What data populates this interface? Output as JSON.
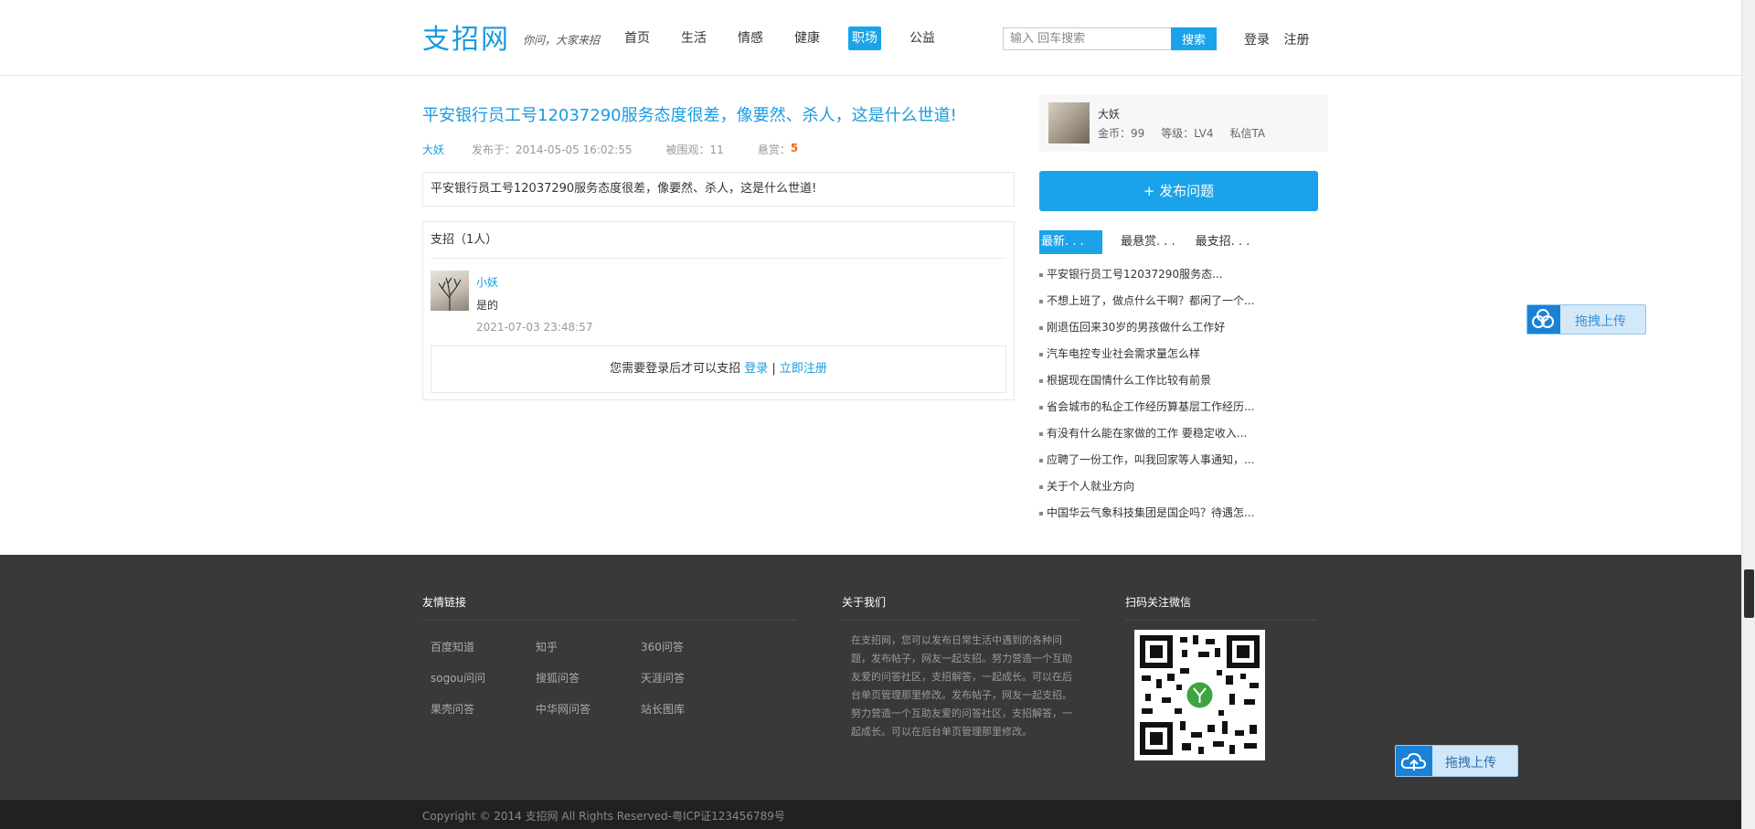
{
  "header": {
    "logo": "支招网",
    "slogan": "你问，大家来招",
    "nav": [
      "首页",
      "生活",
      "情感",
      "健康",
      "职场",
      "公益"
    ],
    "active_nav": "职场",
    "search": {
      "placeholder": "输入 回车搜索",
      "button": "搜索"
    },
    "login": "登录",
    "register": "注册"
  },
  "question": {
    "title": "平安银行员工号12037290服务态度很差，像要然、杀人，这是什么世道!",
    "author": "大妖",
    "published": "发布于：2014-05-05 16:02:55",
    "views": "被围观：11",
    "reward_label": "悬赏：",
    "reward": "5",
    "body": "平安银行员工号12037290服务态度很差，像要然、杀人，这是什么世道!"
  },
  "answers": {
    "header": "支招（1人）",
    "items": [
      {
        "user": "小妖",
        "text": "是的",
        "time": "2021-07-03 23:48:57"
      }
    ],
    "login_tip": "您需要登录后才可以支招",
    "login_link": "登录",
    "separator": "|",
    "register_link": "立即注册"
  },
  "user_card": {
    "name": "大妖",
    "coins": "金币：99",
    "level": "等级：LV4",
    "message": "私信TA"
  },
  "post_button": "+ 发布问题",
  "tabs": [
    "最新. . .",
    "最悬赏. . .",
    "最支招. . ."
  ],
  "latest_list": [
    "平安银行员工号12037290服务态...",
    "不想上班了，做点什么干啊？都闲了一个...",
    "刚退伍回来30岁的男孩做什么工作好",
    "汽车电控专业社会需求量怎么样",
    "根据现在国情什么工作比较有前景",
    "省会城市的私企工作经历算基层工作经历...",
    "有没有什么能在家做的工作 要稳定收入...",
    "应聘了一份工作，叫我回家等人事通知，...",
    "关于个人就业方向",
    "中国华云气象科技集团是国企吗？待遇怎..."
  ],
  "upload_label": "拖拽上传",
  "footer": {
    "links_title": "友情链接",
    "links": [
      "百度知道",
      "知乎",
      "360问答",
      "sogou问问",
      "搜狐问答",
      "天涯问答",
      "果壳问答",
      "中华网问答",
      "站长图库"
    ],
    "about_title": "关于我们",
    "about_text": "在支招网，您可以发布日常生活中遇到的各种问题，发布帖子，网友一起支招。努力营造一个互助友爱的问答社区，支招解答，一起成长。可以在后台单页管理那里修改。发布帖子，网友一起支招。努力营造一个互助友爱的问答社区，支招解答，一起成长。可以在后台单页管理那里修改。",
    "wechat_title": "扫码关注微信",
    "copyright": "Copyright © 2014 支招网 All Rights Reserved-粤ICP证123456789号"
  },
  "colors": {
    "accent": "#1aa3ea",
    "link": "#1a9be0",
    "reward": "#f26b18",
    "footer_bg": "#393939"
  }
}
